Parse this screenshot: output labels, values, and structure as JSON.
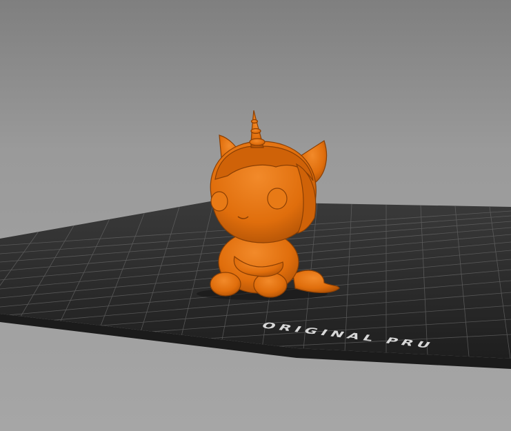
{
  "viewport": {
    "background_top": "#7f7f7f",
    "background_bottom": "#a6a6a6"
  },
  "build_plate": {
    "label": "ORIGINAL PRU",
    "color": "#2b2b2b",
    "grid_color": "#6a6a6a"
  },
  "model": {
    "name": "unicorn",
    "color": "#e06e0c",
    "icon": "unicorn-figurine"
  }
}
